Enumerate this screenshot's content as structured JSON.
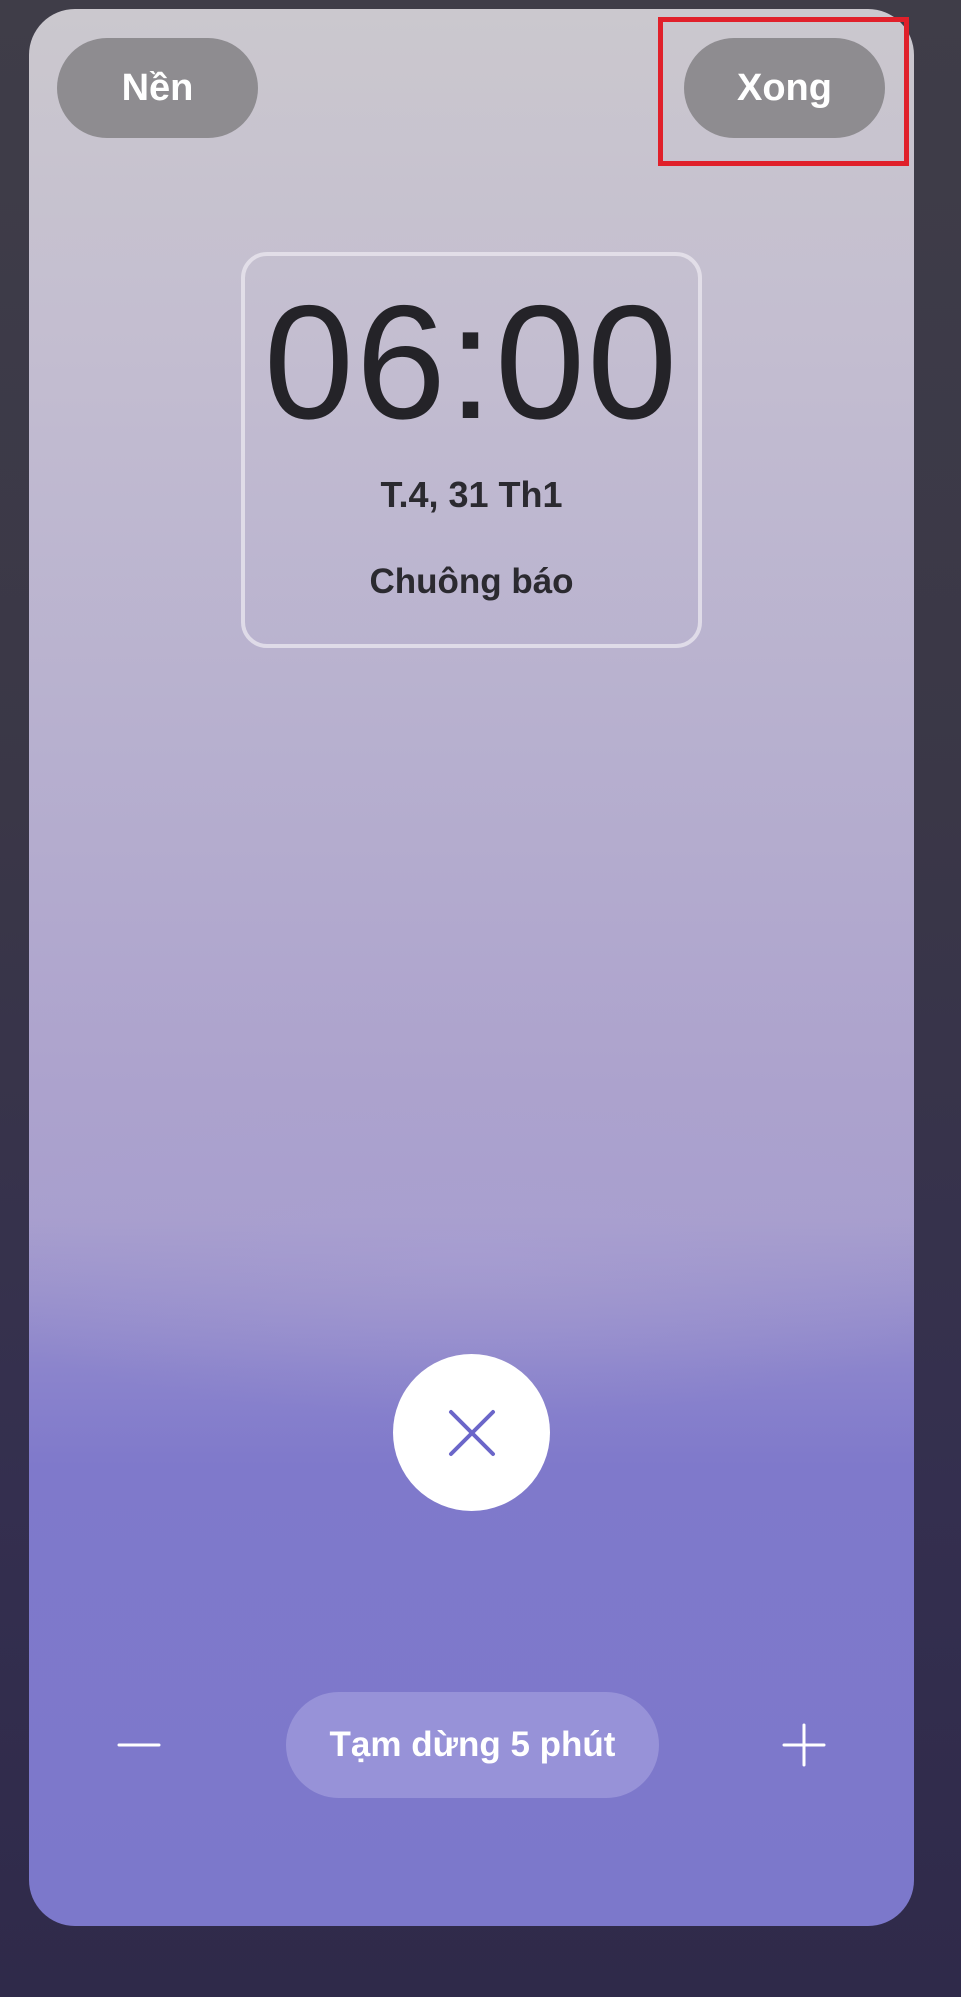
{
  "header": {
    "background_label": "Nền",
    "done_label": "Xong"
  },
  "clock": {
    "time": "06:00",
    "date": "T.4, 31 Th1",
    "label": "Chuông báo"
  },
  "controls": {
    "dismiss_icon": "close-icon",
    "snooze_label": "Tạm dừng 5 phút",
    "decrease_icon": "minus-icon",
    "increase_icon": "plus-icon"
  },
  "colors": {
    "accent": "#6b66c9",
    "highlight": "#e0202a"
  }
}
